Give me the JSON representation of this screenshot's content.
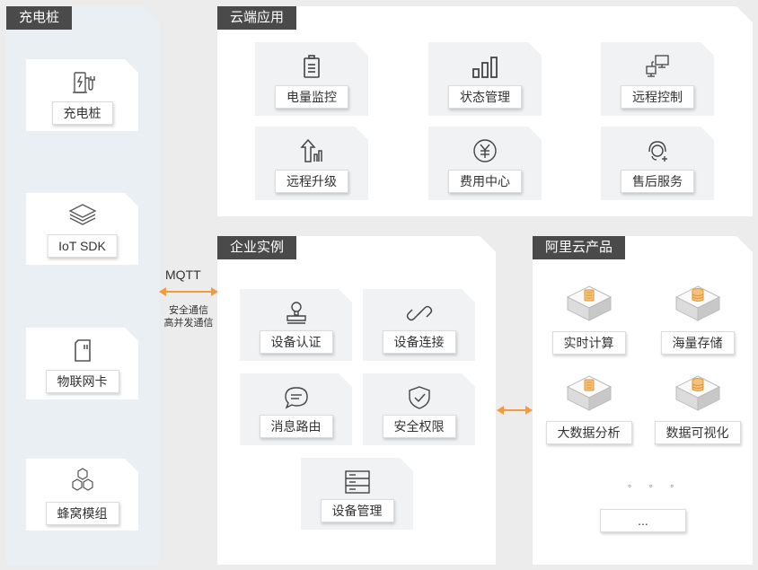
{
  "colors": {
    "accent": "#f39a3c",
    "label_bg": "#4a4a4a",
    "left_panel": "#eaeff4",
    "panel": "#ffffff"
  },
  "charging": {
    "title": "充电桩",
    "items": [
      {
        "label": "充电桩",
        "icon": "charging-pile-icon"
      },
      {
        "label": "IoT SDK",
        "icon": "layers-icon"
      },
      {
        "label": "物联网卡",
        "icon": "sim-card-icon"
      },
      {
        "label": "蜂窝模组",
        "icon": "hexagon-module-icon"
      }
    ]
  },
  "cloud_apps": {
    "title": "云端应用",
    "items": [
      {
        "label": "电量监控",
        "icon": "battery-icon"
      },
      {
        "label": "状态管理",
        "icon": "bar-status-icon"
      },
      {
        "label": "远程控制",
        "icon": "remote-computers-icon"
      },
      {
        "label": "远程升级",
        "icon": "upgrade-arrow-icon"
      },
      {
        "label": "费用中心",
        "icon": "yen-coin-icon"
      },
      {
        "label": "售后服务",
        "icon": "customer-service-icon"
      }
    ]
  },
  "connection": {
    "protocol": "MQTT",
    "note_line1": "安全通信",
    "note_line2": "高并发通信"
  },
  "enterprise": {
    "title": "企业实例",
    "items": [
      {
        "label": "设备认证",
        "icon": "stamp-icon"
      },
      {
        "label": "设备连接",
        "icon": "link-icon"
      },
      {
        "label": "消息路由",
        "icon": "message-icon"
      },
      {
        "label": "安全权限",
        "icon": "shield-check-icon"
      },
      {
        "label": "设备管理",
        "icon": "server-rack-icon"
      }
    ]
  },
  "aliyun": {
    "title": "阿里云产品",
    "items": [
      {
        "label": "实时计算",
        "icon": "calculator-cube-icon"
      },
      {
        "label": "海量存储",
        "icon": "storage-cube-icon"
      },
      {
        "label": "大数据分析",
        "icon": "calculator-cube-icon"
      },
      {
        "label": "数据可视化",
        "icon": "storage-cube-icon"
      }
    ],
    "dots": "◦ ◦ ◦",
    "more": "..."
  }
}
